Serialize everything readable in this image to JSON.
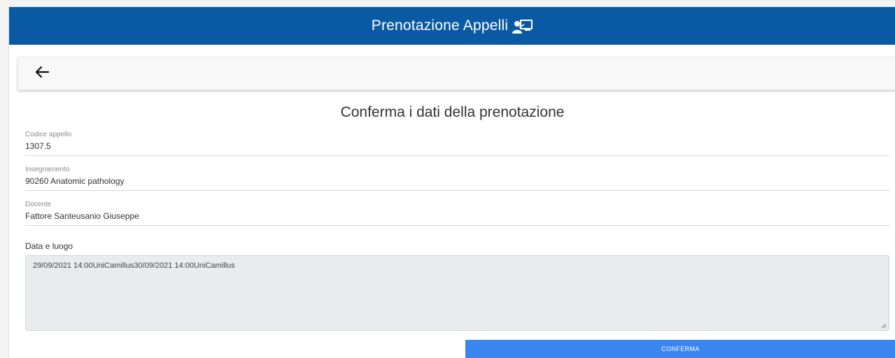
{
  "header": {
    "title": "Prenotazione Appelli",
    "title_icon": "teacher-board-icon",
    "background_color": "#0a5aa3"
  },
  "navbar": {
    "back_icon": "arrow-left-icon"
  },
  "main": {
    "heading": "Conferma i dati della prenotazione",
    "fields": [
      {
        "label": "Codice appello",
        "value": "1307.5"
      },
      {
        "label": "Insegnamento",
        "value": "90260 Anatomic pathology"
      },
      {
        "label": "Docente",
        "value": "Fattore Santeusanio Giuseppe"
      }
    ],
    "date_place": {
      "label": "Data e luogo",
      "value": "29/09/2021 14:00UniCamillus30/09/2021 14:00UniCamillus"
    },
    "confirm_label": "CONFERMA",
    "confirm_color": "#3b86ee"
  }
}
